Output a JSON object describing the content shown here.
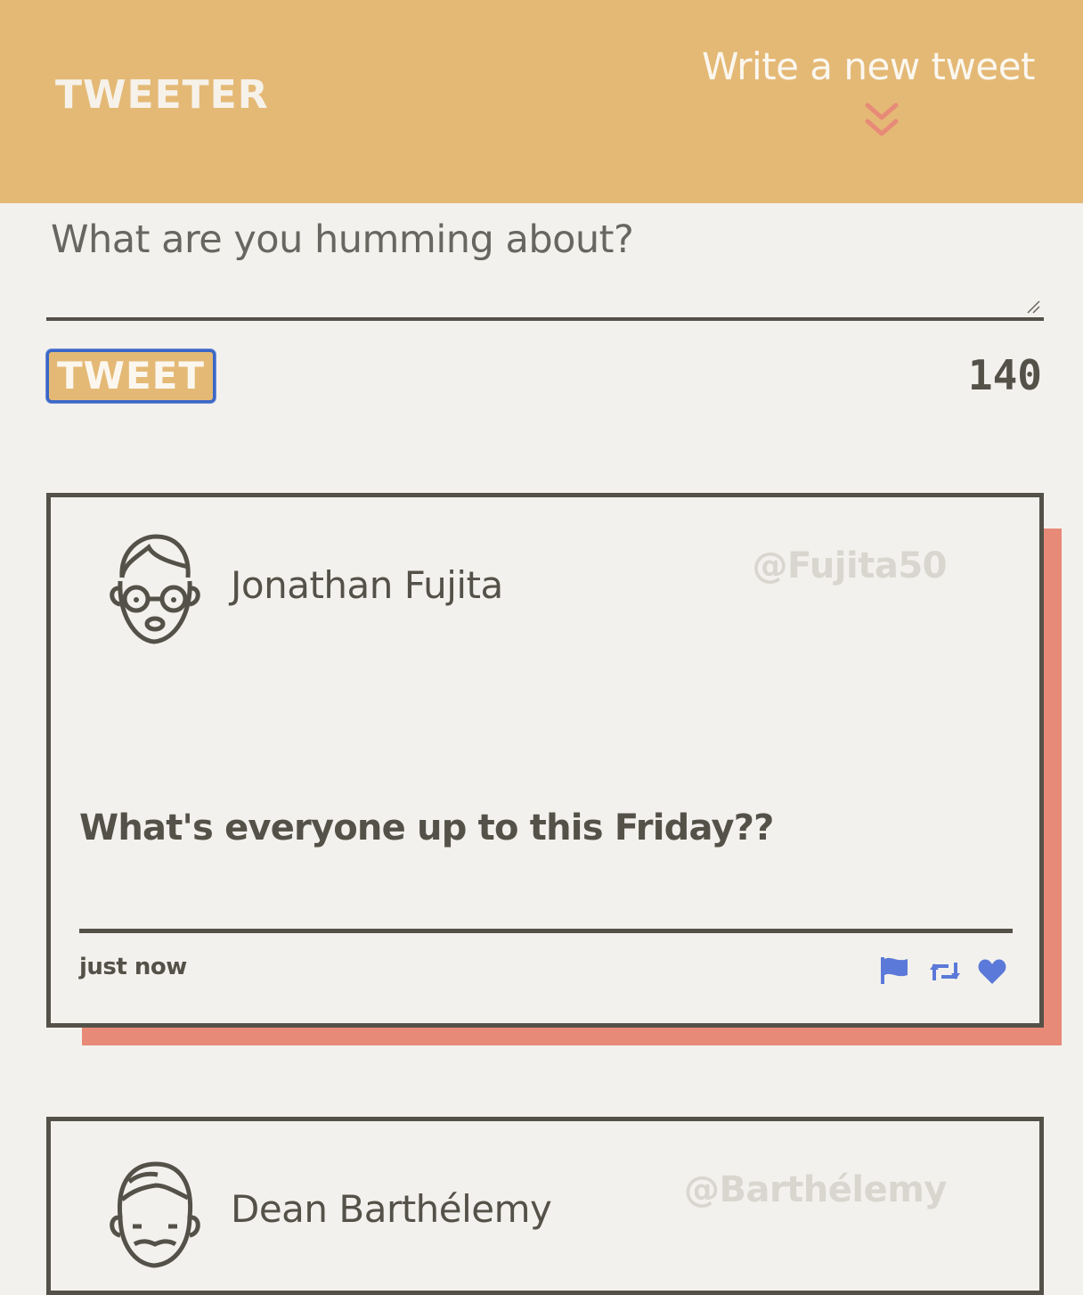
{
  "header": {
    "logo": "TWEETER",
    "compose_link": "Write a new tweet"
  },
  "composer": {
    "placeholder": "What are you humming about?",
    "submit_label": "TWEET",
    "char_count": "140"
  },
  "tweets": [
    {
      "name": "Jonathan Fujita",
      "handle": "@Fujita50",
      "text": "What's everyone up to this Friday??",
      "time": "just now"
    },
    {
      "name": "Dean Barthélemy",
      "handle": "@Barthélemy"
    }
  ],
  "colors": {
    "header_bg": "#e4b976",
    "page_bg": "#f3f1ed",
    "text": "#545149",
    "accent_shadow": "#e88a78",
    "icon_blue": "#5a79d8",
    "chevron": "#e88a78"
  },
  "icons": [
    "double-chevron-down-icon",
    "avatar-icon",
    "flag-icon",
    "retweet-icon",
    "heart-icon"
  ]
}
